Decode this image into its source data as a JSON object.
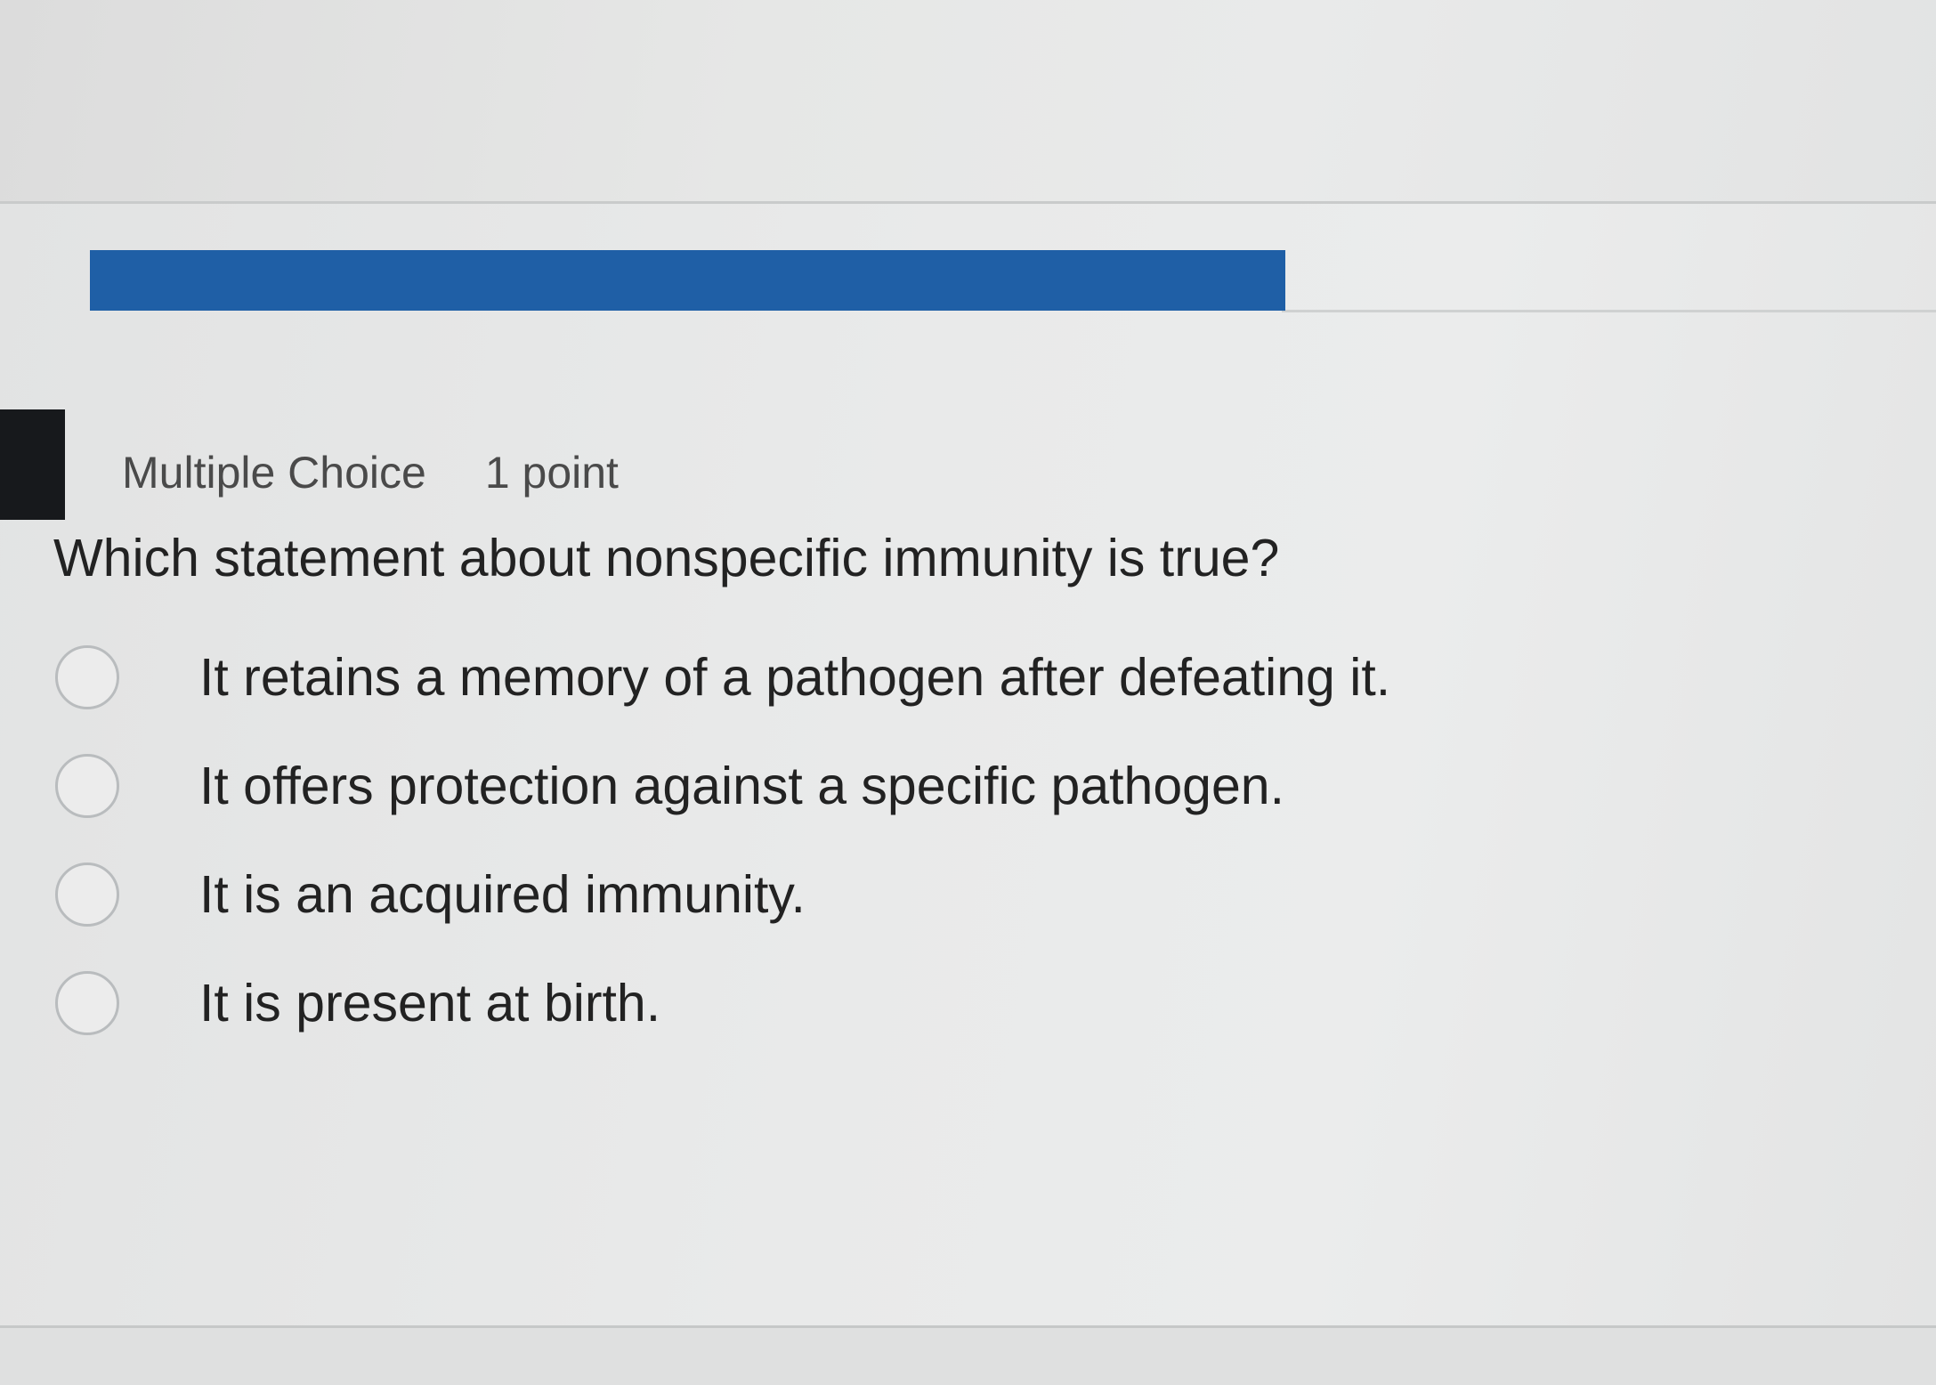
{
  "question": {
    "type_label": "Multiple Choice",
    "points_label": "1 point",
    "text": "Which statement about nonspecific immunity is true?",
    "options": [
      {
        "label": "It retains a memory of a pathogen after defeating it."
      },
      {
        "label": "It offers protection against a specific pathogen."
      },
      {
        "label": "It is an acquired immunity."
      },
      {
        "label": "It is present at birth."
      }
    ]
  },
  "progress": {
    "fraction_complete": 0.62,
    "color": "#1f5fa6"
  }
}
